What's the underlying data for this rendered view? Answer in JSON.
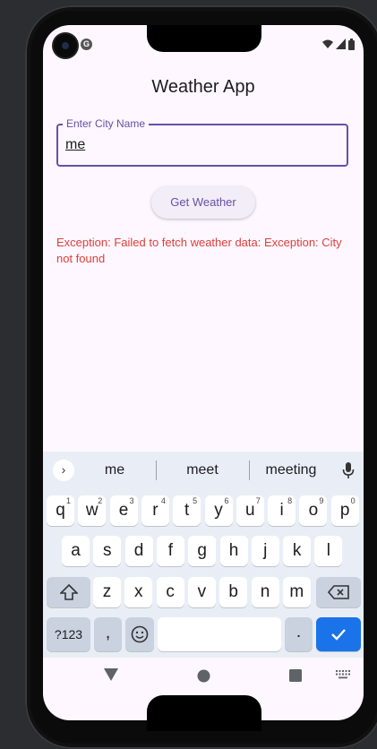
{
  "app": {
    "title": "Weather App",
    "city_field": {
      "label": "Enter City Name",
      "value": "me"
    },
    "get_weather_label": "Get Weather",
    "error_message": "Exception: Failed to fetch weather data: Exception: City not found"
  },
  "status_bar": {
    "left_icons": [
      "camera-cutout",
      "google-g-icon"
    ],
    "right_icons": [
      "wifi-icon",
      "signal-icon",
      "battery-icon"
    ]
  },
  "keyboard": {
    "suggestions": [
      "me",
      "meet",
      "meeting"
    ],
    "row1": [
      {
        "k": "q",
        "n": "1"
      },
      {
        "k": "w",
        "n": "2"
      },
      {
        "k": "e",
        "n": "3"
      },
      {
        "k": "r",
        "n": "4"
      },
      {
        "k": "t",
        "n": "5"
      },
      {
        "k": "y",
        "n": "6"
      },
      {
        "k": "u",
        "n": "7"
      },
      {
        "k": "i",
        "n": "8"
      },
      {
        "k": "o",
        "n": "9"
      },
      {
        "k": "p",
        "n": "0"
      }
    ],
    "row2": [
      "a",
      "s",
      "d",
      "f",
      "g",
      "h",
      "j",
      "k",
      "l"
    ],
    "row3": [
      "z",
      "x",
      "c",
      "v",
      "b",
      "n",
      "m"
    ],
    "symbols_label": "?123",
    "comma_label": ",",
    "period_label": ".",
    "icons": {
      "expand": "chevron-right-icon",
      "mic": "mic-icon",
      "shift": "shift-icon",
      "backspace": "backspace-icon",
      "emoji": "emoji-icon",
      "enter": "check-icon"
    }
  },
  "nav_bar": {
    "icons": [
      "back-triangle-icon",
      "home-circle-icon",
      "recents-square-icon",
      "keyboard-switch-icon"
    ]
  },
  "colors": {
    "primary": "#6750a4",
    "error": "#dc3f3a",
    "enter_key": "#1a73e8",
    "background": "#fef7ff"
  }
}
